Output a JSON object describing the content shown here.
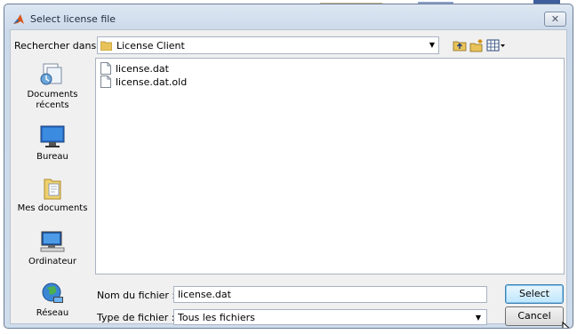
{
  "window": {
    "title": "Select license file",
    "close_glyph": "✕"
  },
  "toolbar": {
    "look_in_label": "Rechercher dans :",
    "look_in_value": "License Client",
    "dropdown_glyph": "▼",
    "icons": [
      "up-folder-icon",
      "new-folder-icon",
      "view-menu-icon"
    ]
  },
  "places": [
    {
      "label": "Documents récents",
      "icon": "recent-documents-icon"
    },
    {
      "label": "Bureau",
      "icon": "desktop-icon"
    },
    {
      "label": "Mes documents",
      "icon": "my-documents-icon"
    },
    {
      "label": "Ordinateur",
      "icon": "computer-icon"
    },
    {
      "label": "Réseau",
      "icon": "network-icon"
    }
  ],
  "files": [
    {
      "name": "license.dat",
      "icon": "file-icon"
    },
    {
      "name": "license.dat.old",
      "icon": "file-icon"
    }
  ],
  "form": {
    "file_name_label": "Nom du fichier :",
    "file_name_value": "license.dat",
    "file_type_label": "Type de fichier :",
    "file_type_value": "Tous les fichiers"
  },
  "buttons": {
    "select": "Select",
    "cancel": "Cancel"
  },
  "colors": {
    "title_bar": "#cbd9ea",
    "client_bg": "#f0f0f0",
    "select_button": "#bee6fd"
  }
}
